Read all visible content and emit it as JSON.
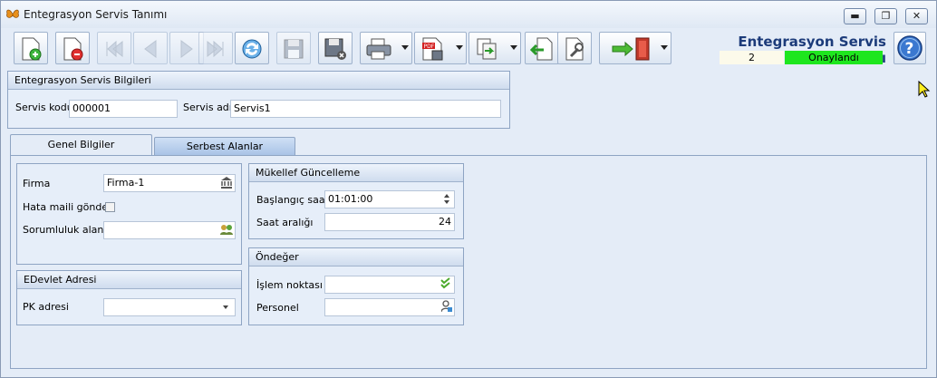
{
  "window": {
    "title": "Entegrasyon Servis Tanımı",
    "minimize_glyph": "▬",
    "maximize_glyph": "❐",
    "close_glyph": "✕"
  },
  "header": {
    "title": "Entegrasyon Servis Tanımı",
    "record_number": "2",
    "status": "Onaylandı",
    "status_color": "#1ee61e"
  },
  "toolbar": {
    "buttons": [
      {
        "icon": "new-document-icon",
        "enabled": true
      },
      {
        "icon": "delete-document-icon",
        "enabled": true
      },
      {
        "icon": "first-record-icon",
        "enabled": false
      },
      {
        "icon": "previous-record-icon",
        "enabled": false
      },
      {
        "icon": "next-record-icon",
        "enabled": false
      },
      {
        "icon": "last-record-icon",
        "enabled": false
      },
      {
        "icon": "refresh-icon",
        "enabled": true
      },
      {
        "icon": "save-icon",
        "enabled": false
      },
      {
        "icon": "save-close-icon",
        "enabled": true
      },
      {
        "icon": "print-icon",
        "enabled": true
      },
      {
        "icon": "pdf-export-icon",
        "enabled": true
      },
      {
        "icon": "copy-icon",
        "enabled": true
      },
      {
        "icon": "import-icon",
        "enabled": true
      },
      {
        "icon": "settings-tools-icon",
        "enabled": true
      },
      {
        "icon": "exit-icon",
        "enabled": true
      },
      {
        "icon": "help-icon",
        "enabled": true
      }
    ]
  },
  "service_info": {
    "title": "Entegrasyon Servis Bilgileri",
    "code_label": "Servis kodu",
    "code_value": "000001",
    "name_label": "Servis adı",
    "name_value": "Servis1"
  },
  "tabs": [
    {
      "label": "Genel Bilgiler",
      "active": true
    },
    {
      "label": "Serbest Alanlar",
      "active": false
    }
  ],
  "general": {
    "firma_label": "Firma",
    "firma_value": "Firma-1",
    "hata_label": "Hata maili gönder",
    "hata_checked": false,
    "sorumluluk_label": "Sorumluluk alanı",
    "sorumluluk_value": ""
  },
  "edevlet": {
    "title": "EDevlet Adresi",
    "pk_label": "PK adresi",
    "pk_value": ""
  },
  "mukellef": {
    "title": "Mükellef Güncelleme",
    "start_label": "Başlangıç saati",
    "start_value": "01:01:00",
    "interval_label": "Saat aralığı",
    "interval_value": "24"
  },
  "ondeger": {
    "title": "Öndeğer",
    "islem_label": "İşlem noktası",
    "islem_value": "",
    "personel_label": "Personel",
    "personel_value": ""
  }
}
